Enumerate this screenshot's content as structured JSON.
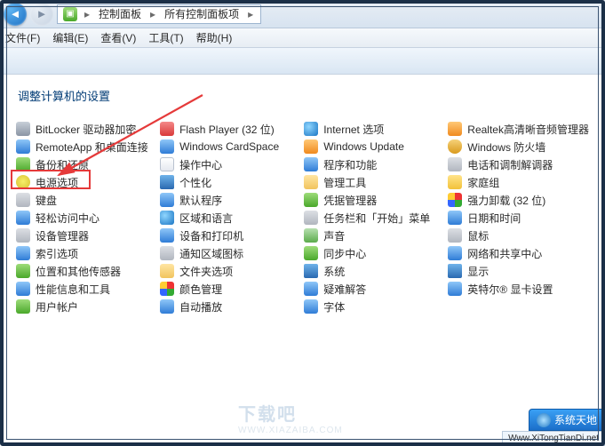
{
  "nav": {
    "back_glyph": "◄",
    "fwd_glyph": "►",
    "crumb_icon": "▣",
    "crumb1": "控制面板",
    "crumb2": "所有控制面板项",
    "sep": "▸"
  },
  "menu": {
    "file": "文件(F)",
    "edit": "编辑(E)",
    "view": "查看(V)",
    "tools": "工具(T)",
    "help": "帮助(H)"
  },
  "heading": "调整计算机的设置",
  "cols": [
    [
      {
        "id": "bitlocker",
        "label": "BitLocker 驱动器加密",
        "ic": "ic-lock"
      },
      {
        "id": "remoteapp",
        "label": "RemoteApp 和桌面连接",
        "ic": "ic-blue"
      },
      {
        "id": "backup",
        "label": "备份和还原",
        "ic": "ic-green"
      },
      {
        "id": "power",
        "label": "电源选项",
        "ic": "ic-power"
      },
      {
        "id": "keyboard",
        "label": "键盘",
        "ic": "ic-gray"
      },
      {
        "id": "ease",
        "label": "轻松访问中心",
        "ic": "ic-blue"
      },
      {
        "id": "devmgr",
        "label": "设备管理器",
        "ic": "ic-gray"
      },
      {
        "id": "index",
        "label": "索引选项",
        "ic": "ic-blue"
      },
      {
        "id": "sensors",
        "label": "位置和其他传感器",
        "ic": "ic-green"
      },
      {
        "id": "perf",
        "label": "性能信息和工具",
        "ic": "ic-blue"
      },
      {
        "id": "users",
        "label": "用户帐户",
        "ic": "ic-green"
      }
    ],
    [
      {
        "id": "flash",
        "label": "Flash Player (32 位)",
        "ic": "ic-red"
      },
      {
        "id": "cardspace",
        "label": "Windows CardSpace",
        "ic": "ic-blue"
      },
      {
        "id": "action",
        "label": "操作中心",
        "ic": "ic-flag"
      },
      {
        "id": "personal",
        "label": "个性化",
        "ic": "ic-display"
      },
      {
        "id": "defaults",
        "label": "默认程序",
        "ic": "ic-blue"
      },
      {
        "id": "region",
        "label": "区域和语言",
        "ic": "ic-globe"
      },
      {
        "id": "printers",
        "label": "设备和打印机",
        "ic": "ic-blue"
      },
      {
        "id": "notifyicons",
        "label": "通知区域图标",
        "ic": "ic-gray"
      },
      {
        "id": "folderopt",
        "label": "文件夹选项",
        "ic": "ic-folder"
      },
      {
        "id": "colormgmt",
        "label": "颜色管理",
        "ic": "ic-multi"
      },
      {
        "id": "autoplay",
        "label": "自动播放",
        "ic": "ic-blue"
      }
    ],
    [
      {
        "id": "inetopt",
        "label": "Internet 选项",
        "ic": "ic-globe"
      },
      {
        "id": "winupdate",
        "label": "Windows Update",
        "ic": "ic-orange"
      },
      {
        "id": "progfeat",
        "label": "程序和功能",
        "ic": "ic-blue"
      },
      {
        "id": "admintools",
        "label": "管理工具",
        "ic": "ic-folder"
      },
      {
        "id": "credmgr",
        "label": "凭据管理器",
        "ic": "ic-green"
      },
      {
        "id": "taskbar",
        "label": "任务栏和「开始」菜单",
        "ic": "ic-gray"
      },
      {
        "id": "sound",
        "label": "声音",
        "ic": "ic-audio"
      },
      {
        "id": "sync",
        "label": "同步中心",
        "ic": "ic-green"
      },
      {
        "id": "system",
        "label": "系统",
        "ic": "ic-display"
      },
      {
        "id": "troubleshoot",
        "label": "疑难解答",
        "ic": "ic-blue"
      },
      {
        "id": "fonts",
        "label": "字体",
        "ic": "ic-blue"
      }
    ],
    [
      {
        "id": "realtek",
        "label": "Realtek高清晰音频管理器",
        "ic": "ic-orange"
      },
      {
        "id": "firewall",
        "label": "Windows 防火墙",
        "ic": "ic-shield"
      },
      {
        "id": "modem",
        "label": "电话和调制解调器",
        "ic": "ic-gray"
      },
      {
        "id": "homegroup",
        "label": "家庭组",
        "ic": "ic-yellow"
      },
      {
        "id": "qiangli",
        "label": "强力卸载 (32 位)",
        "ic": "ic-multi"
      },
      {
        "id": "datetime",
        "label": "日期和时间",
        "ic": "ic-blue"
      },
      {
        "id": "mouse",
        "label": "鼠标",
        "ic": "ic-gray"
      },
      {
        "id": "netshare",
        "label": "网络和共享中心",
        "ic": "ic-blue"
      },
      {
        "id": "display",
        "label": "显示",
        "ic": "ic-display"
      },
      {
        "id": "intelgfx",
        "label": "英特尔® 显卡设置",
        "ic": "ic-blue"
      }
    ]
  ],
  "highlight_target": "power",
  "watermark": {
    "center_big": "下载吧",
    "center_small": "WWW.XIAZAIBA.COM",
    "pill": "系统天地",
    "site": "Www.XiTongTianDi.net"
  }
}
